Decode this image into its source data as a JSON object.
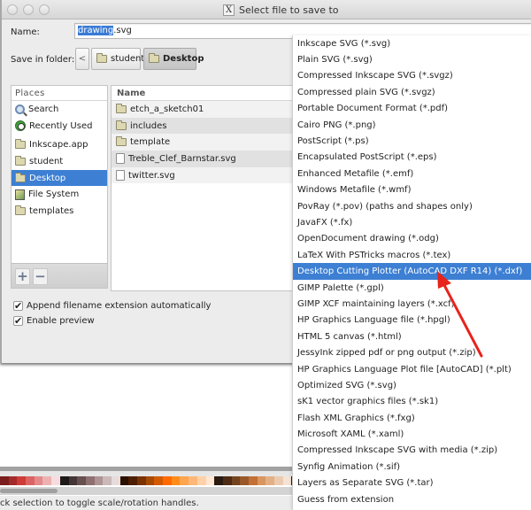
{
  "window": {
    "title": "Select file to save to",
    "title_icon": "x11-icon"
  },
  "form": {
    "name_label": "Name:",
    "name_value_selected": "drawing",
    "name_value_rest": ".svg",
    "folder_label": "Save in folder:",
    "path_back": "<",
    "path_buttons": [
      {
        "label": "student",
        "icon": "folder-icon",
        "active": false
      },
      {
        "label": "Desktop",
        "icon": "folder-icon",
        "active": true
      }
    ]
  },
  "places": {
    "header": "Places",
    "items": [
      {
        "label": "Search",
        "icon": "search-icon"
      },
      {
        "label": "Recently Used",
        "icon": "recent-icon"
      },
      {
        "label": "Inkscape.app",
        "icon": "folder-icon"
      },
      {
        "label": "student",
        "icon": "folder-icon"
      },
      {
        "label": "Desktop",
        "icon": "folder-icon",
        "selected": true
      },
      {
        "label": "File System",
        "icon": "filesystem-icon"
      },
      {
        "label": "templates",
        "icon": "folder-icon"
      }
    ],
    "add_label": "+",
    "remove_label": "−"
  },
  "files": {
    "header": "Name",
    "items": [
      {
        "name": "etch_a_sketch01",
        "type": "folder"
      },
      {
        "name": "includes",
        "type": "folder"
      },
      {
        "name": "template",
        "type": "folder"
      },
      {
        "name": "Treble_Clef_Barnstar.svg",
        "type": "file"
      },
      {
        "name": "twitter.svg",
        "type": "file"
      }
    ]
  },
  "options": {
    "append_extension": {
      "label": "Append filename extension automatically",
      "checked": true
    },
    "enable_preview": {
      "label": "Enable preview",
      "checked": true
    },
    "check_glyph": "✔"
  },
  "file_types": {
    "selected_index": 14,
    "items": [
      "Inkscape SVG (*.svg)",
      "Plain SVG (*.svg)",
      "Compressed Inkscape SVG (*.svgz)",
      "Compressed plain SVG (*.svgz)",
      "Portable Document Format (*.pdf)",
      "Cairo PNG (*.png)",
      "PostScript (*.ps)",
      "Encapsulated PostScript (*.eps)",
      "Enhanced Metafile (*.emf)",
      "Windows Metafile (*.wmf)",
      "PovRay (*.pov) (paths and shapes only)",
      "JavaFX (*.fx)",
      "OpenDocument drawing (*.odg)",
      "LaTeX With PSTricks macros (*.tex)",
      "Desktop Cutting Plotter (AutoCAD DXF R14) (*.dxf)",
      "GIMP Palette (*.gpl)",
      "GIMP XCF maintaining layers (*.xcf)",
      "HP Graphics Language file (*.hpgl)",
      "HTML 5 canvas (*.html)",
      "JessyInk zipped pdf or png output (*.zip)",
      "HP Graphics Language Plot file [AutoCAD] (*.plt)",
      "Optimized SVG (*.svg)",
      "sK1 vector graphics files (*.sk1)",
      "Flash XML Graphics (*.fxg)",
      "Microsoft XAML (*.xaml)",
      "Compressed Inkscape SVG with media (*.zip)",
      "Synfig Animation (*.sif)",
      "Layers as Separate SVG (*.tar)",
      "Guess from extension"
    ]
  },
  "annotation": {
    "type": "arrow",
    "color": "#e8231b",
    "points_to": "Desktop Cutting Plotter (AutoCAD DXF R14) (*.dxf)"
  },
  "background_app": {
    "status_text": "ck selection to toggle scale/rotation handles.",
    "palette": [
      "#7a1d1d",
      "#a32a2a",
      "#cf3b36",
      "#dc6363",
      "#e48a8a",
      "#eeb1b1",
      "#f7dcdf",
      "#1e1a1a",
      "#443636",
      "#675050",
      "#8f7070",
      "#ae9494",
      "#cbb8b8",
      "#e6dcdc",
      "#2b1000",
      "#4d1e02",
      "#7a3300",
      "#a64a00",
      "#d35a00",
      "#ff6a00",
      "#ff8c1a",
      "#ffa54d",
      "#ffb878",
      "#ffd1a8",
      "#ffe7d4",
      "#2a1a0f",
      "#4d2b14",
      "#74441f",
      "#99592a",
      "#c27036",
      "#d9965f",
      "#e3b086",
      "#ebcbb0",
      "#f5e3d6",
      "#1c1c1c"
    ],
    "colors": {
      "accent": "#3d7fd3",
      "selection": "#3a7bd5",
      "dialog_bg": "#ececec"
    }
  }
}
